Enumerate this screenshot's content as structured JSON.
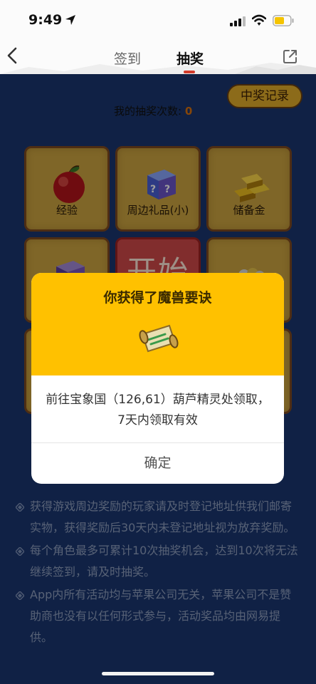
{
  "status_bar": {
    "time": "9:49"
  },
  "nav": {
    "tabs": [
      {
        "label": "签到"
      },
      {
        "label": "抽奖"
      }
    ]
  },
  "lottery": {
    "record_button": "中奖记录",
    "count_label": "我的抽奖次数: ",
    "count_value": "0",
    "start_label": "开始",
    "tiles": [
      {
        "label": "经验",
        "icon": "apple-icon"
      },
      {
        "label": "周边礼品(小)",
        "icon": "mystery-box-icon"
      },
      {
        "label": "储备金",
        "icon": "gold-bars-icon"
      }
    ]
  },
  "rules": [
    "获得游戏周边奖励的玩家请及时登记地址供我们邮寄实物，获得奖励后30天内未登记地址视为放弃奖励。",
    "每个角色最多可累计10次抽奖机会，达到10次将无法继续签到，请及时抽奖。",
    "App内所有活动均与苹果公司无关，苹果公司不是赞助商也没有以任何形式参与，活动奖品均由网易提供。"
  ],
  "dialog": {
    "title": "你获得了魔兽要诀",
    "icon": "scroll-icon",
    "message": "前往宝象国（126,61）葫芦精灵处领取，7天内领取有效",
    "confirm_label": "确定"
  },
  "colors": {
    "page_bg": "#1a3670",
    "tile_bg": "#cda541",
    "start_bg": "#d04a4a",
    "dialog_header": "#ffc100",
    "count_accent": "#d87210",
    "tab_underline": "#d23b2b"
  }
}
